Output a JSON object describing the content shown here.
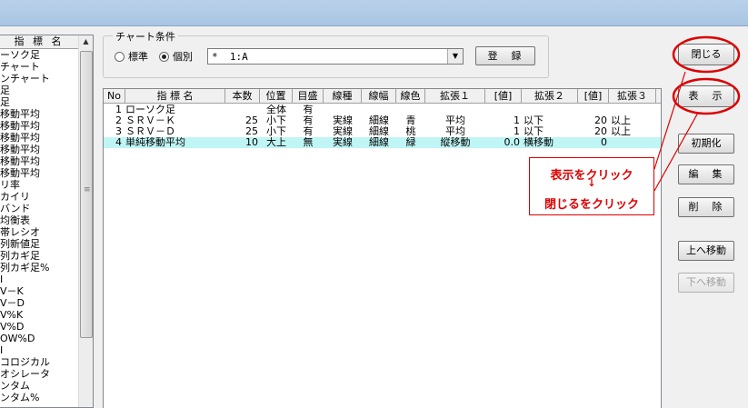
{
  "sidebar": {
    "header": "指 標 名",
    "items": [
      "ーソク足",
      "チャート",
      "ンチャート",
      "足",
      "足",
      "移動平均",
      "移動平均",
      "移動平均",
      "移動平均",
      "移動平均",
      "移動平均",
      "リ率",
      "カイリ",
      "バンド",
      "均衡表",
      "帯レシオ",
      "列新値足",
      "列カギ足",
      "列カギ足%",
      "I",
      "V－K",
      "V－D",
      "V%K",
      "V%D",
      "OW%D",
      "I",
      "コロジカル",
      "オシレータ",
      "ンタム",
      "ンタム%"
    ]
  },
  "chart_condition": {
    "legend": "チャート条件",
    "radio_standard": "標準",
    "radio_individual": "個別",
    "selected": "個別",
    "combo_value": "*  1:A",
    "register_button": "登　録"
  },
  "grid": {
    "columns": [
      "No",
      "指 標 名",
      "本数",
      "位置",
      "目盛",
      "線種",
      "線幅",
      "線色",
      "拡張１",
      "[値]",
      "拡張２",
      "[値]",
      "拡張３"
    ],
    "rows": [
      {
        "no": "1",
        "name": "ローソク足",
        "count": "",
        "position": "全体",
        "scale": "有",
        "linetype": "",
        "linewidth": "",
        "color": "",
        "ext1": "",
        "val1": "",
        "ext2": "",
        "val2": "",
        "ext3": "",
        "selected": false
      },
      {
        "no": "2",
        "name": "ＳＲＶ－Ｋ",
        "count": "25",
        "position": "小下",
        "scale": "有",
        "linetype": "実線",
        "linewidth": "細線",
        "color": "青",
        "ext1": "平均",
        "val1": "1",
        "ext2": "以下",
        "val2": "20",
        "ext3": "以上",
        "selected": false
      },
      {
        "no": "3",
        "name": "ＳＲＶ－Ｄ",
        "count": "25",
        "position": "小下",
        "scale": "有",
        "linetype": "実線",
        "linewidth": "細線",
        "color": "桃",
        "ext1": "平均",
        "val1": "1",
        "ext2": "以下",
        "val2": "20",
        "ext3": "以上",
        "selected": false
      },
      {
        "no": "4",
        "name": "単純移動平均",
        "count": "10",
        "position": "大上",
        "scale": "無",
        "linetype": "実線",
        "linewidth": "細線",
        "color": "緑",
        "ext1": "縦移動",
        "val1": "0.0",
        "ext2": "横移動",
        "val2": "0",
        "ext3": "",
        "selected": true
      }
    ]
  },
  "buttons": {
    "close": "閉じる",
    "display": "表　示",
    "initialize": "初期化",
    "edit": "編　集",
    "delete": "削　除",
    "move_up": "上へ移動",
    "move_down": "下へ移動"
  },
  "annotation": {
    "line1": "表示をクリック",
    "arrow": "↓",
    "line2": "閉じるをクリック",
    "color": "#dd0000"
  }
}
